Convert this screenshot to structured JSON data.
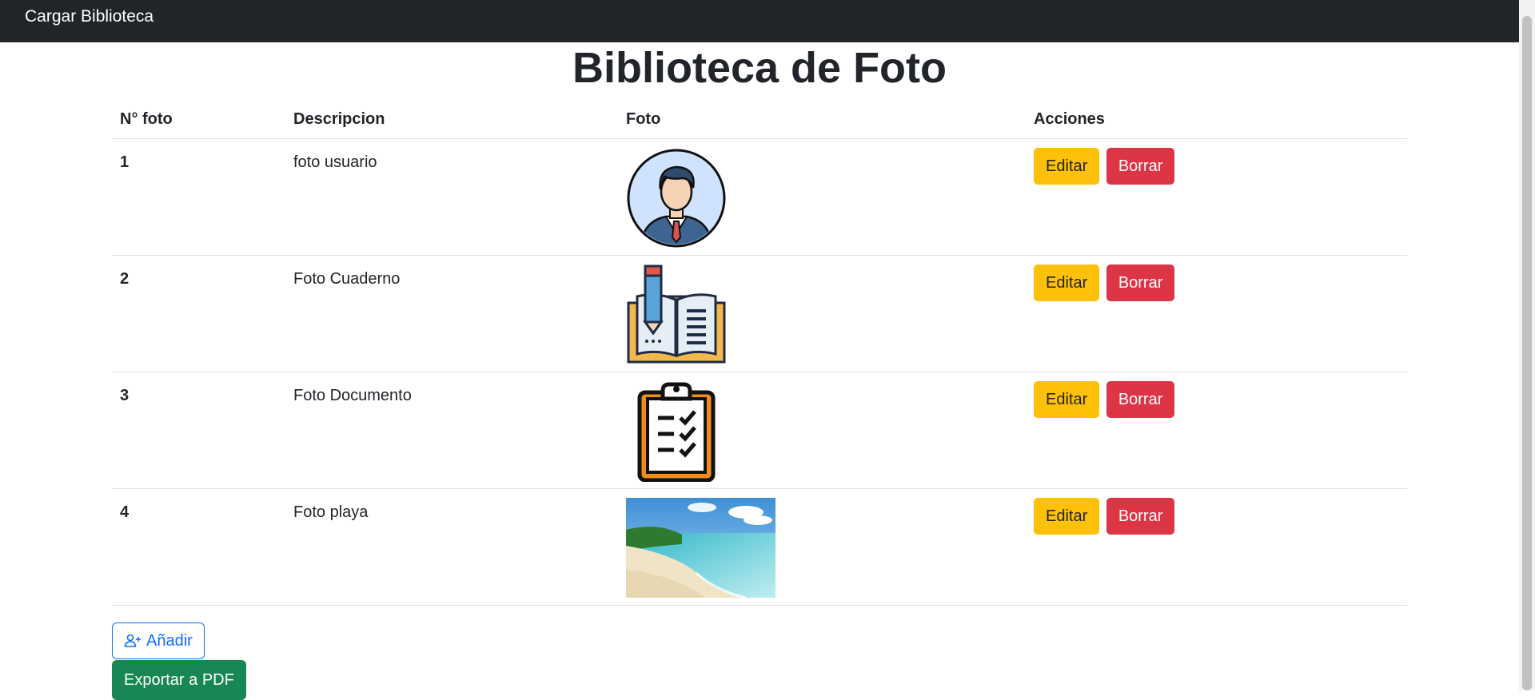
{
  "navbar": {
    "brand": "Cargar Biblioteca"
  },
  "page": {
    "title": "Biblioteca de Foto"
  },
  "table": {
    "headers": [
      "N° foto",
      "Descripcion",
      "Foto",
      "Acciones"
    ],
    "rows": [
      {
        "num": "1",
        "desc": "foto usuario",
        "photo": "user-avatar-image"
      },
      {
        "num": "2",
        "desc": "Foto Cuaderno",
        "photo": "notebook-image"
      },
      {
        "num": "3",
        "desc": "Foto Documento",
        "photo": "clipboard-image"
      },
      {
        "num": "4",
        "desc": "Foto playa",
        "photo": "beach-image"
      }
    ],
    "edit_label": "Editar",
    "delete_label": "Borrar"
  },
  "actions": {
    "add_label": "Añadir",
    "pdf_label": "Exportar a PDF"
  },
  "colors": {
    "navbar": "#212529",
    "edit": "#ffc107",
    "delete": "#dc3545",
    "add": "#0d6efd",
    "pdf": "#198754"
  }
}
